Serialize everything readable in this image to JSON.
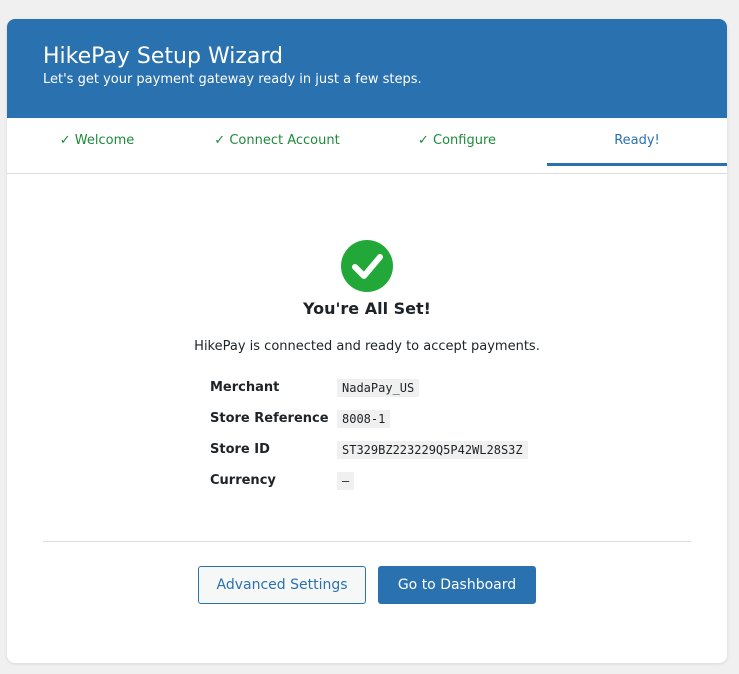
{
  "header": {
    "title": "HikePay Setup Wizard",
    "subtitle": "Let's get your payment gateway ready in just a few steps."
  },
  "steps": [
    {
      "label": "✓ Welcome",
      "state": "complete"
    },
    {
      "label": "✓ Connect Account",
      "state": "complete"
    },
    {
      "label": "✓ Configure",
      "state": "complete"
    },
    {
      "label": "Ready!",
      "state": "active"
    }
  ],
  "done": {
    "icon": "check-circle-icon",
    "title": "You're All Set!",
    "text": "HikePay is connected and ready to accept payments."
  },
  "details": [
    {
      "label": "Merchant",
      "value": "NadaPay_US"
    },
    {
      "label": "Store Reference",
      "value": "8008-1"
    },
    {
      "label": "Store ID",
      "value": "ST329BZ223229Q5P42WL28S3Z"
    },
    {
      "label": "Currency",
      "value": "–"
    }
  ],
  "actions": {
    "advanced_label": "Advanced Settings",
    "dashboard_label": "Go to Dashboard"
  },
  "colors": {
    "brand": "#2a71b0",
    "success": "#22a838",
    "step_complete": "#1e8a3a"
  }
}
